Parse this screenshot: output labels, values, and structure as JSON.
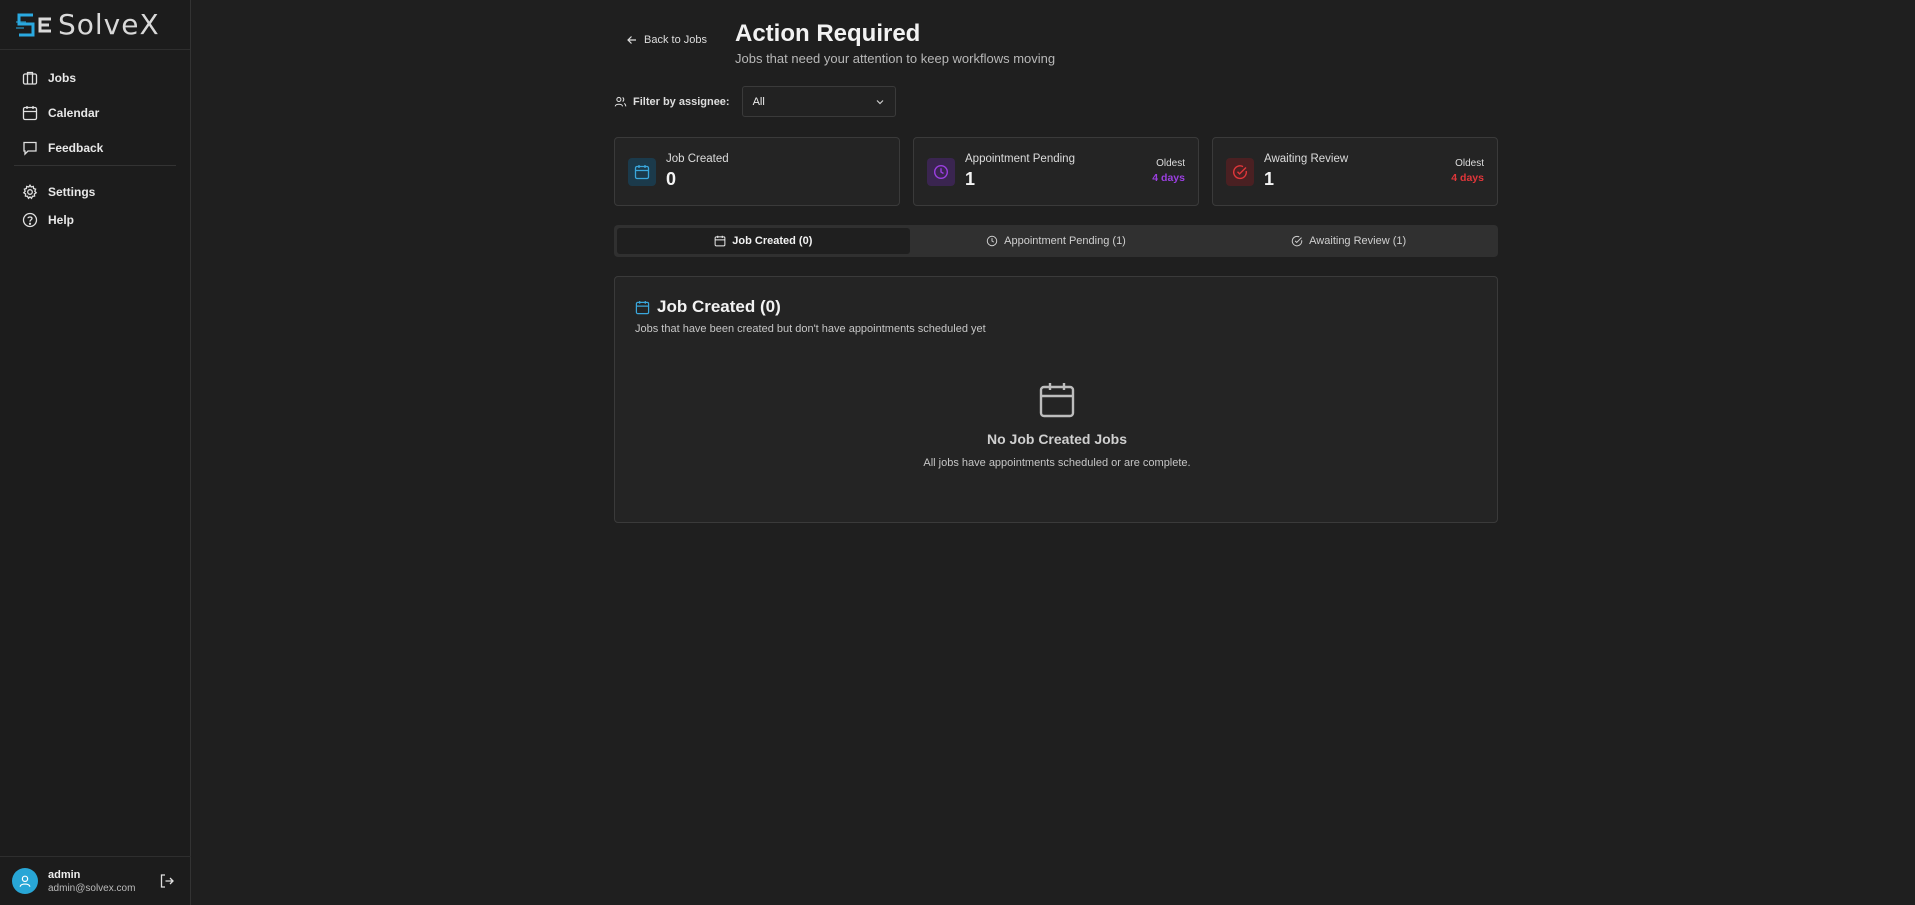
{
  "app": {
    "name": "SolveX"
  },
  "sidebar": {
    "items": [
      {
        "label": "Jobs",
        "icon": "briefcase-icon"
      },
      {
        "label": "Calendar",
        "icon": "calendar-icon"
      },
      {
        "label": "Feedback",
        "icon": "message-icon"
      }
    ],
    "secondary": [
      {
        "label": "Settings",
        "icon": "gear-icon"
      },
      {
        "label": "Help",
        "icon": "help-circle-icon"
      }
    ],
    "user": {
      "name": "admin",
      "email": "admin@solvex.com"
    }
  },
  "header": {
    "back_label": "Back to Jobs",
    "title": "Action Required",
    "subtitle": "Jobs that need your attention to keep workflows moving"
  },
  "filter": {
    "label": "Filter by assignee:",
    "value": "All"
  },
  "cards": [
    {
      "label": "Job Created",
      "count": "0",
      "accent": "#3aa7dc"
    },
    {
      "label": "Appointment Pending",
      "count": "1",
      "oldest_label": "Oldest",
      "oldest_value": "4 days",
      "accent": "#9b3fe0"
    },
    {
      "label": "Awaiting Review",
      "count": "1",
      "oldest_label": "Oldest",
      "oldest_value": "4 days",
      "accent": "#e0363a"
    }
  ],
  "tabs": [
    {
      "label": "Job Created (0)",
      "active": true
    },
    {
      "label": "Appointment Pending (1)",
      "active": false
    },
    {
      "label": "Awaiting Review (1)",
      "active": false
    }
  ],
  "panel": {
    "title": "Job Created (0)",
    "description": "Jobs that have been created but don't have appointments scheduled yet",
    "empty_title": "No Job Created Jobs",
    "empty_description": "All jobs have appointments scheduled or are complete."
  }
}
